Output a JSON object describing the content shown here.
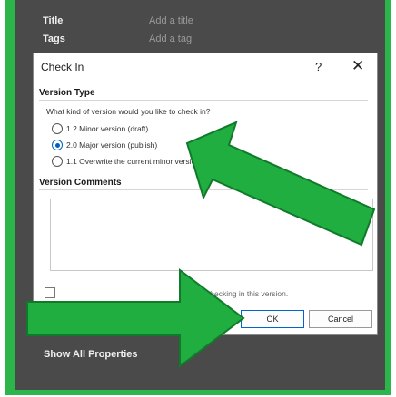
{
  "background_panel": {
    "title_label": "Title",
    "title_placeholder": "Add a title",
    "tags_label": "Tags",
    "tags_placeholder": "Add a tag",
    "show_all": "Show All Properties"
  },
  "dialog": {
    "title": "Check In",
    "help": "?",
    "close": "✕",
    "version_type_header": "Version Type",
    "question": "What kind of version would you like to check in?",
    "options": [
      {
        "label": "1.2  Minor version (draft)",
        "selected": false
      },
      {
        "label": "2.0  Major version (publish)",
        "selected": true
      },
      {
        "label": "1.1  Overwrite the current minor version",
        "selected": false
      }
    ],
    "comments_header": "Version Comments",
    "comments_value": "",
    "keep_checked_out_text": "checking in this version.",
    "ok_label": "OK",
    "cancel_label": "Cancel"
  },
  "colors": {
    "frame_green": "#2bb54a",
    "arrow_green": "#1fae3f",
    "dark_panel": "#4a4a4a",
    "accent_blue": "#0060c0"
  }
}
